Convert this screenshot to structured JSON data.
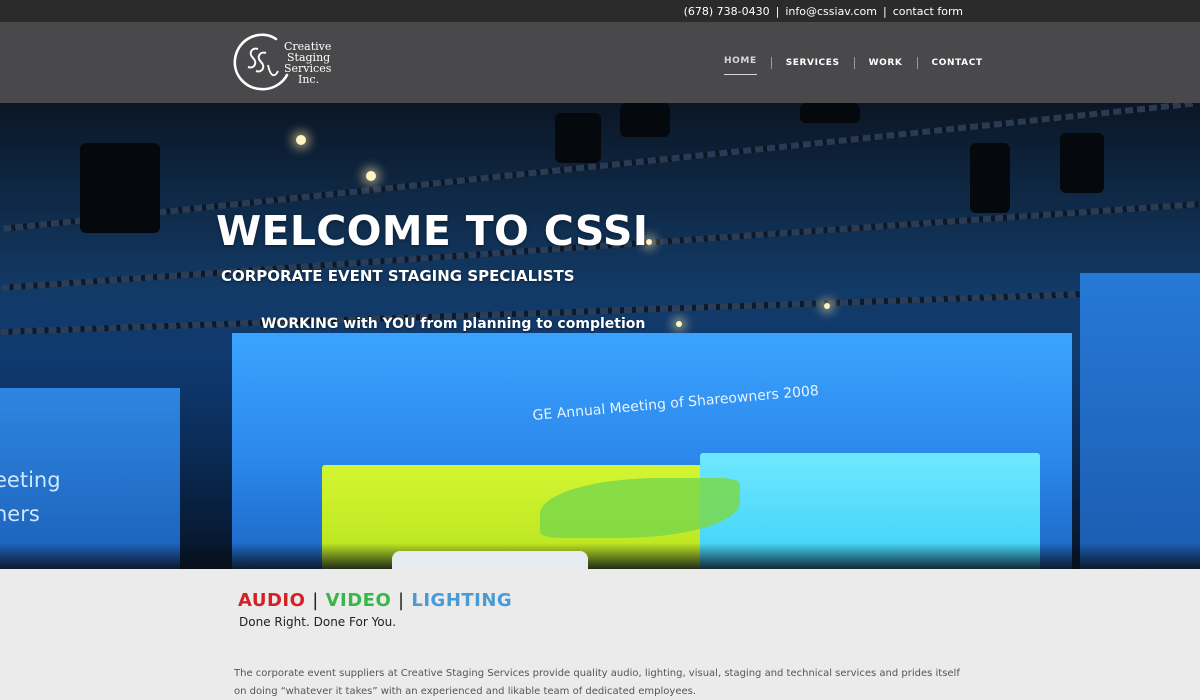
{
  "topbar": {
    "phone": "(678) 738-0430",
    "email": "info@cssiav.com",
    "contact_form": "contact form",
    "separator": "|"
  },
  "logo": {
    "line1": "Creative",
    "line2": "Staging",
    "line3": "Services",
    "line4": "Inc."
  },
  "nav": {
    "items": [
      {
        "label": "HOME",
        "active": true
      },
      {
        "label": "SERVICES",
        "active": false
      },
      {
        "label": "WORK",
        "active": false
      },
      {
        "label": "CONTACT",
        "active": false
      }
    ]
  },
  "hero": {
    "title": "WELCOME TO CSSI",
    "subtitle": "CORPORATE EVENT STAGING SPECIALISTS",
    "tagline": "WORKING with YOU from planning to completion",
    "screen_caption": "GE Annual Meeting of Shareowners 2008",
    "screen_left_text": "eeting\nners"
  },
  "services_heading": {
    "audio": "AUDIO",
    "video": "VIDEO",
    "lighting": "LIGHTING",
    "separator": "|",
    "tagline": "Done Right. Done For You."
  },
  "about": {
    "text": "The corporate event suppliers at Creative Staging Services provide quality audio, lighting, visual, staging and technical services and prides itself on doing “whatever it takes” with an experienced and likable team of dedicated employees."
  },
  "colors": {
    "topbar_bg": "#2b2b2c",
    "header_bg": "#49494b",
    "audio": "#d42027",
    "video": "#39b54a",
    "lighting": "#4a9ad6"
  }
}
